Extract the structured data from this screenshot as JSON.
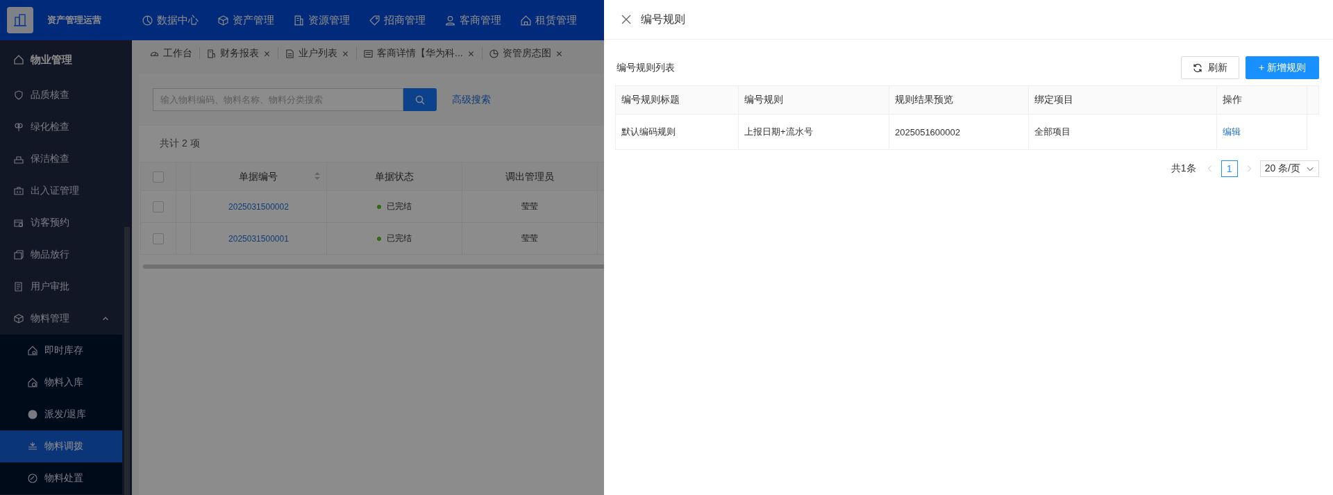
{
  "header": {
    "app_title": "资产管理运营",
    "nav": [
      "数据中心",
      "资产管理",
      "资源管理",
      "招商管理",
      "客商管理",
      "租赁管理"
    ]
  },
  "tabs": [
    {
      "label": "工作台",
      "closable": false
    },
    {
      "label": "财务报表",
      "closable": true
    },
    {
      "label": "业户列表",
      "closable": true
    },
    {
      "label": "客商详情【华为科...",
      "closable": true
    },
    {
      "label": "资管房态图",
      "closable": true
    }
  ],
  "sidebar": {
    "section": "物业管理",
    "items": [
      {
        "label": "品质核查",
        "selected": false
      },
      {
        "label": "绿化检查",
        "selected": false
      },
      {
        "label": "保洁检查",
        "selected": false
      },
      {
        "label": "出入证管理",
        "selected": false
      },
      {
        "label": "访客预约",
        "selected": false
      },
      {
        "label": "物品放行",
        "selected": false
      },
      {
        "label": "用户审批",
        "selected": false
      },
      {
        "label": "物料管理",
        "selected": false,
        "expanded": true,
        "children": [
          {
            "label": "即时库存",
            "selected": false
          },
          {
            "label": "物料入库",
            "selected": false
          },
          {
            "label": "派发/退库",
            "selected": false
          },
          {
            "label": "物料调拨",
            "selected": true
          },
          {
            "label": "物料处置",
            "selected": false
          }
        ]
      }
    ]
  },
  "search": {
    "placeholder": "输入物料编码、物料名称、物料分类搜索",
    "advanced_link": "高级搜索"
  },
  "summary": "共计 2 项",
  "table": {
    "header_checked": false,
    "columns": [
      {
        "label": "单据编号",
        "sortable": true
      },
      {
        "label": "单据状态",
        "sortable": false
      },
      {
        "label": "调出管理员",
        "sortable": false
      }
    ],
    "rows": [
      {
        "checked": false,
        "number": "2025031500002",
        "status": {
          "text": "已完结",
          "color": "#2d6c0e"
        },
        "admin": "莹莹"
      },
      {
        "checked": false,
        "number": "2025031500001",
        "status": {
          "text": "已完结",
          "color": "#2d6c0e"
        },
        "admin": "莹莹"
      }
    ]
  },
  "drawer": {
    "title": "编号规则",
    "list_title": "编号规则列表",
    "buttons": [
      {
        "label": "刷新",
        "kind": "default"
      },
      {
        "label": "+ 新增规则",
        "kind": "primary"
      }
    ],
    "table": {
      "columns": [
        "编号规则标题",
        "编号规则",
        "规则结果预览",
        "绑定项目",
        "操作"
      ],
      "rows": [
        {
          "cells": [
            "默认编码规则",
            "上报日期+流水号",
            "2025051600002",
            "全部项目"
          ],
          "action": "编辑"
        }
      ]
    },
    "pagination": {
      "total": "共1条",
      "pages": [
        {
          "label": "1",
          "selected": true
        }
      ],
      "page_size": "20 条/页"
    }
  }
}
